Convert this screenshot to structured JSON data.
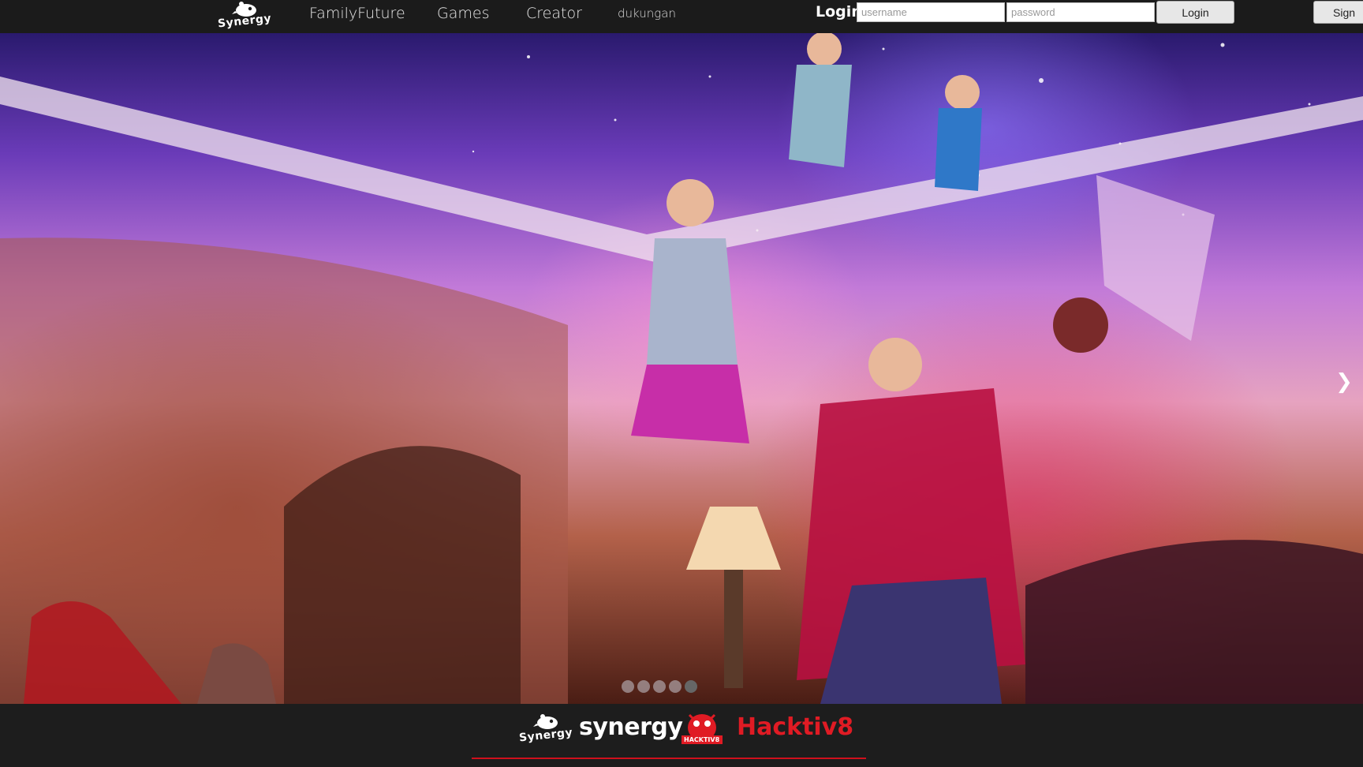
{
  "brand": {
    "logo_text": "Synergy"
  },
  "nav": {
    "links": [
      {
        "label": "FamilyFuture"
      },
      {
        "label": "Games"
      },
      {
        "label": "Creator"
      },
      {
        "label": "dukungan"
      }
    ]
  },
  "login": {
    "label": "Login",
    "username_placeholder": "username",
    "password_placeholder": "password",
    "login_button": "Login",
    "signup_button": "Sign"
  },
  "carousel": {
    "next_glyph": "❯",
    "slide_count": 5,
    "active_index": 4
  },
  "footer": {
    "synergy_logo_text": "Synergy",
    "synergy_wordmark": "synergy",
    "hacktiv_badge": "HACKTIV8",
    "hacktiv_wordmark": "Hacktiv8"
  },
  "colors": {
    "nav_bg": "#1b1b1b",
    "hacktiv_red": "#e01b24",
    "footer_bg": "#1d1d1d"
  }
}
